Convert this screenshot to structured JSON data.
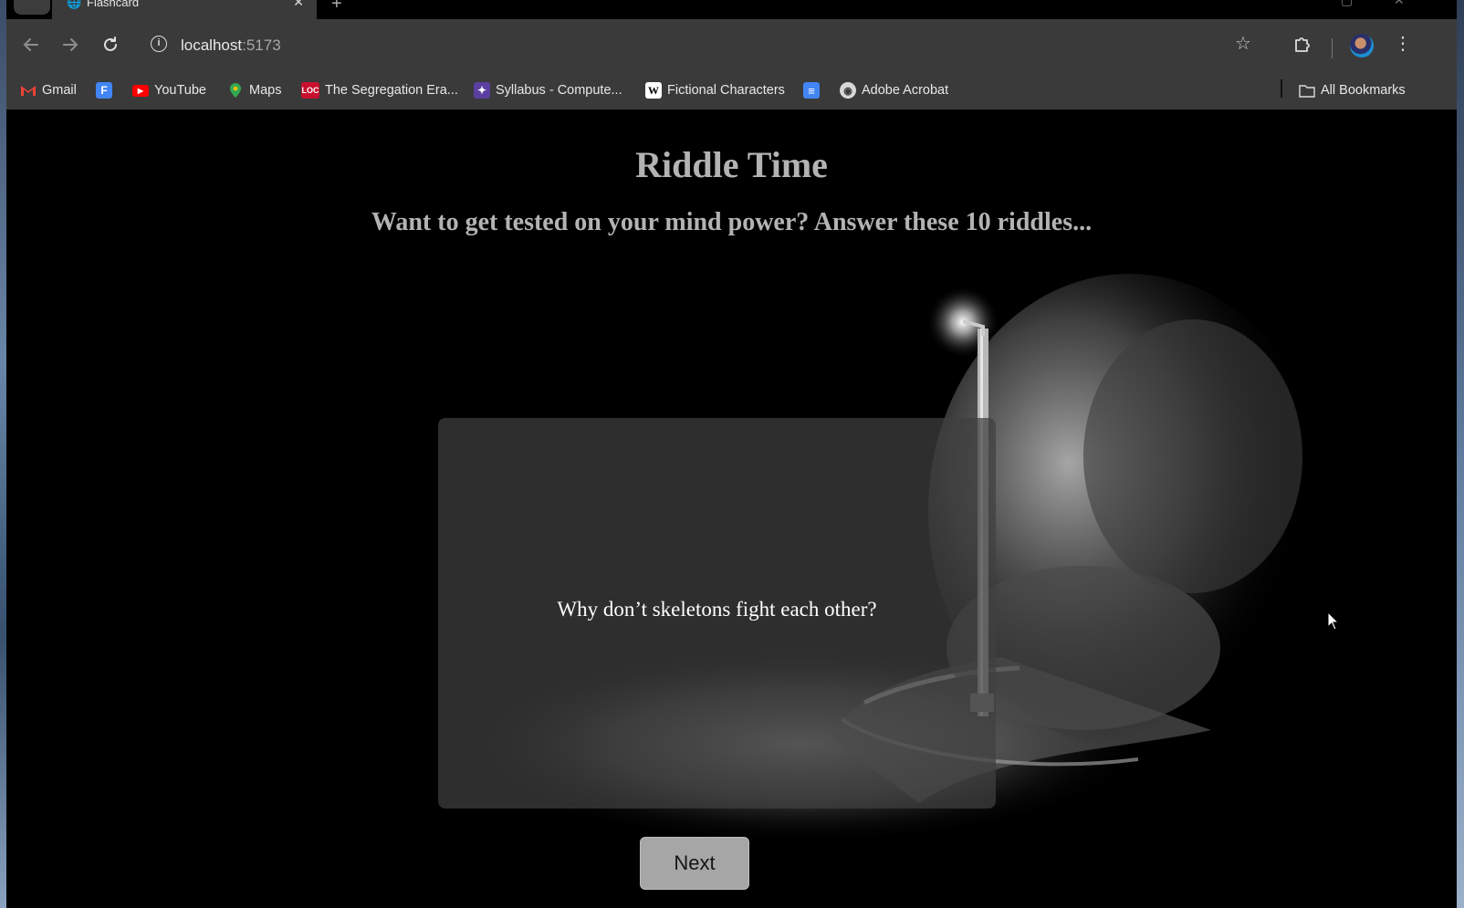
{
  "browser": {
    "tab": {
      "title": "Flashcard",
      "close": "✕"
    },
    "new_tab": "+",
    "url_host": "localhost",
    "url_port": ":5173",
    "bookmarks": [
      {
        "label": "Gmail",
        "icon": "gmail-icon",
        "color": "#ea4335"
      },
      {
        "label": "",
        "icon": "forms-icon",
        "color": "#4285f4"
      },
      {
        "label": "YouTube",
        "icon": "youtube-icon",
        "color": "#ff0000"
      },
      {
        "label": "Maps",
        "icon": "maps-icon",
        "color": "#34a853"
      },
      {
        "label": "The Segregation Era...",
        "icon": "loc-icon",
        "color": "#c8102e"
      },
      {
        "label": "Syllabus - Compute...",
        "icon": "syllabus-icon",
        "color": "#5b3fa0"
      },
      {
        "label": "Fictional Characters",
        "icon": "wikipedia-icon",
        "color": "#ffffff"
      },
      {
        "label": "",
        "icon": "docs-icon",
        "color": "#4285f4"
      },
      {
        "label": "Adobe Acrobat",
        "icon": "globe-icon",
        "color": "#dcdcdc"
      }
    ],
    "all_bookmarks": "All Bookmarks"
  },
  "page": {
    "title": "Riddle Time",
    "subtitle": "Want to get tested on your mind power? Answer these 10 riddles...",
    "card": {
      "question": "Why don’t skeletons fight each other?"
    },
    "next_label": "Next"
  }
}
